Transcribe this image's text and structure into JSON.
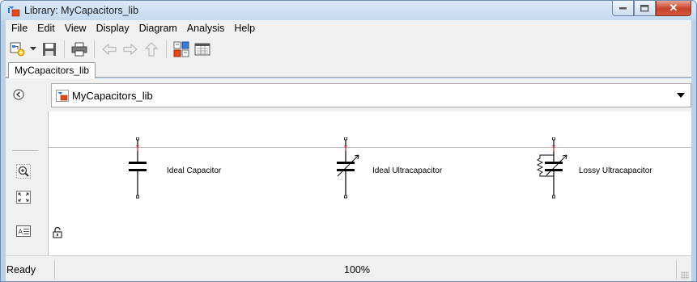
{
  "window": {
    "title": "Library: MyCapacitors_lib",
    "controls": {
      "minimize": "–",
      "maximize": "□",
      "close": "✕"
    }
  },
  "menu": [
    "File",
    "Edit",
    "View",
    "Display",
    "Diagram",
    "Analysis",
    "Help"
  ],
  "toolbar": {
    "buttons": [
      "new-model-icon",
      "dropdown-arrow-icon",
      "save-icon",
      "print-icon",
      "back-arrow-icon",
      "forward-arrow-icon",
      "up-arrow-icon",
      "library-browser-icon",
      "model-explorer-icon"
    ]
  },
  "tabs": [
    {
      "label": "MyCapacitors_lib"
    }
  ],
  "address": {
    "path": "MyCapacitors_lib"
  },
  "palette": [
    "hide-browser-icon",
    "zoom-in-icon",
    "fit-view-icon",
    "annotation-icon"
  ],
  "blocks": [
    {
      "label": "Ideal Capacitor",
      "icon": "capacitor-icon"
    },
    {
      "label": "Ideal Ultracapacitor",
      "icon": "variable-capacitor-icon"
    },
    {
      "label": "Lossy Ultracapacitor",
      "icon": "lossy-capacitor-icon"
    }
  ],
  "status": {
    "left": "Ready",
    "zoom": "100%"
  },
  "colors": {
    "titlebar": "#c4daf0",
    "accent_red": "#e0262a",
    "chrome": "#f0f0f0"
  }
}
